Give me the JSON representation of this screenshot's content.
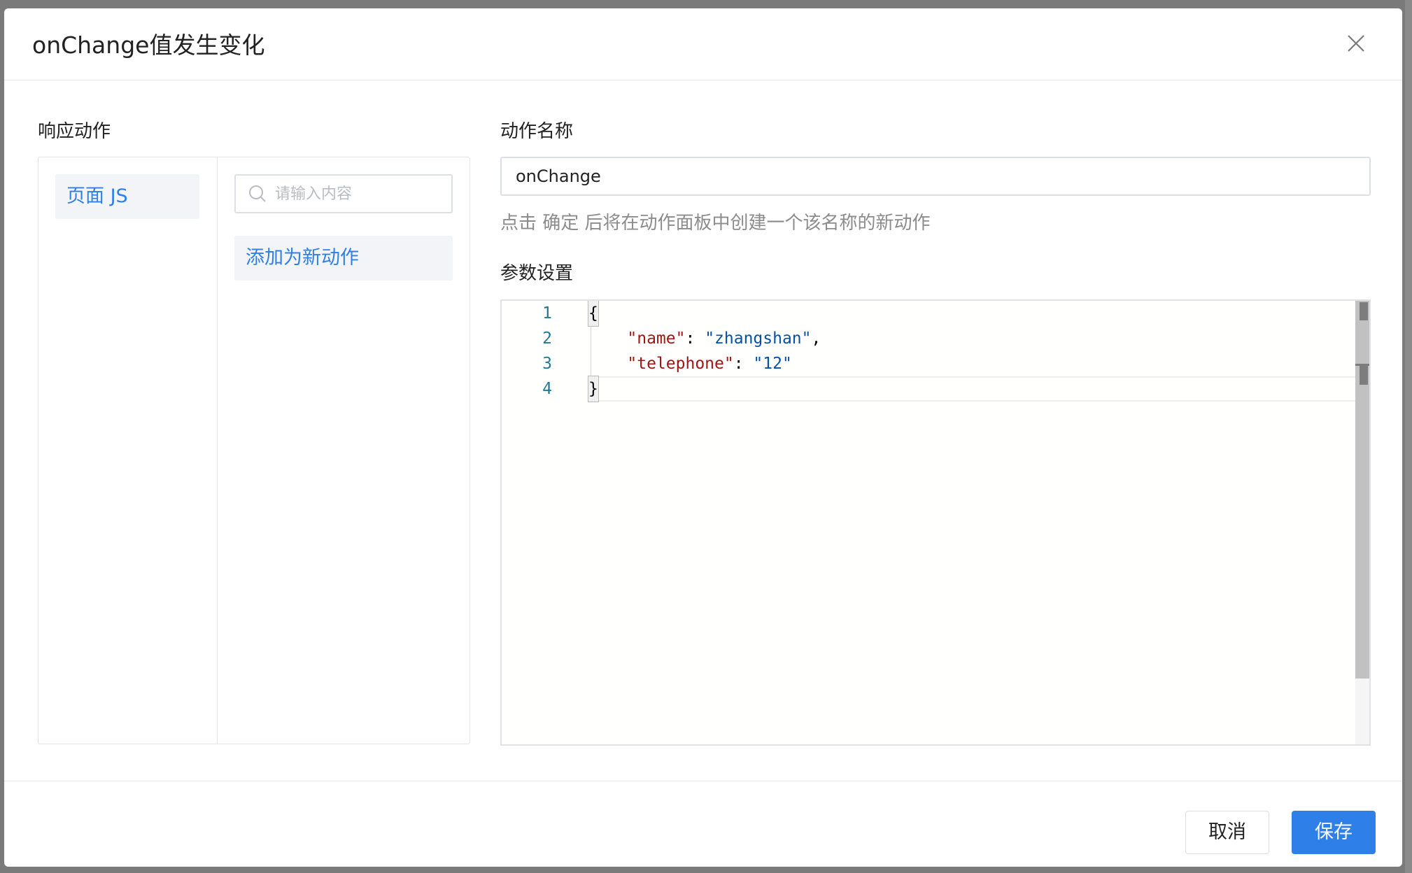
{
  "dialog": {
    "title": "onChange值发生变化",
    "close_icon": "close-icon"
  },
  "response_actions": {
    "label": "响应动作",
    "categories": [
      {
        "label": "页面 JS"
      }
    ],
    "search": {
      "placeholder": "请输入内容",
      "value": "",
      "icon": "search-icon"
    },
    "add_new_label": "添加为新动作"
  },
  "action_name": {
    "label": "动作名称",
    "value": "onChange",
    "hint": "点击 确定 后将在动作面板中创建一个该名称的新动作"
  },
  "params": {
    "label": "参数设置",
    "line_numbers": [
      "1",
      "2",
      "3",
      "4"
    ],
    "code": {
      "open": "{",
      "lines": [
        {
          "key": "\"name\"",
          "colon": ": ",
          "value": "\"zhangshan\"",
          "trail": ","
        },
        {
          "key": "\"telephone\"",
          "colon": ": ",
          "value": "\"12\"",
          "trail": ""
        }
      ],
      "close": "}"
    }
  },
  "footer": {
    "cancel_label": "取消",
    "save_label": "保存"
  },
  "colors": {
    "accent": "#2f7fe8",
    "json_key": "#a31515",
    "json_string": "#0451a5",
    "line_number": "#237893"
  }
}
